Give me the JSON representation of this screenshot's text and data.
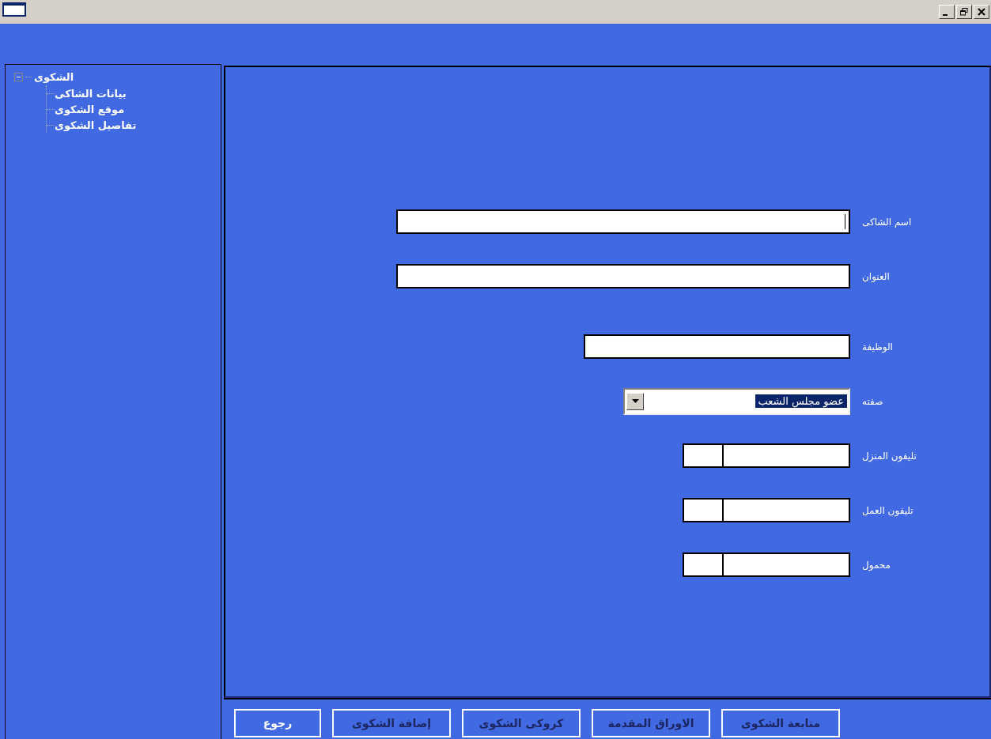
{
  "tree": {
    "label": "الشكوى",
    "expanded": true,
    "children": [
      {
        "label": "بيانات الشاكى"
      },
      {
        "label": "موقع الشكوى"
      },
      {
        "label": "تفاصيل الشكوى"
      }
    ]
  },
  "form": {
    "fields": [
      {
        "kind": "longtext",
        "label": "اسم الشاكى",
        "focused": true
      },
      {
        "kind": "longtext",
        "label": "العنوان",
        "focused": false
      },
      {
        "kind": "shorttext",
        "label": "الوظيفة",
        "focused": false
      },
      {
        "kind": "combo",
        "label": "صفته",
        "value": "عضو مجلس الشعب"
      },
      {
        "kind": "phone",
        "label": "تليفون المنزل"
      },
      {
        "kind": "phone",
        "label": "تليفون العمل"
      },
      {
        "kind": "phone",
        "label": "محمول"
      }
    ]
  },
  "buttons": [
    {
      "label": "متابعة الشكوى",
      "disabled": true
    },
    {
      "label": "الاوراق المقدمة",
      "disabled": true
    },
    {
      "label": "كروكى الشكوى",
      "disabled": true
    },
    {
      "label": "إضافة الشكوى",
      "disabled": true
    },
    {
      "label": "رجوع",
      "disabled": false
    }
  ]
}
